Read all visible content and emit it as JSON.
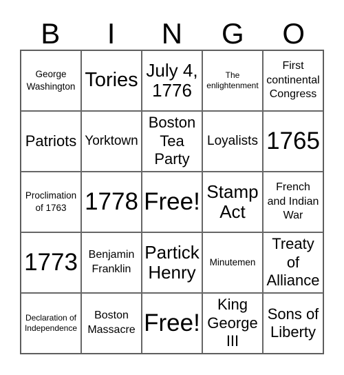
{
  "header": {
    "letters": [
      "B",
      "I",
      "N",
      "G",
      "O"
    ]
  },
  "rows": [
    [
      "George\nWashington",
      "Tories",
      "July 4,\n1776",
      "The\nenlightenment",
      "First\ncontinental\nCongress"
    ],
    [
      "Patriots",
      "Yorktown",
      "Boston\nTea\nParty",
      "Loyalists",
      "1765"
    ],
    [
      "Proclimation\nof 1763",
      "1778",
      "Free!",
      "Stamp\nAct",
      "French\nand Indian\nWar"
    ],
    [
      "1773",
      "Benjamin\nFranklin",
      "Partick\nHenry",
      "Minutemen",
      "Treaty\nof\nAlliance"
    ],
    [
      "Declaration of\nIndependence",
      "Boston\nMassacre",
      "Free!",
      "King\nGeorge\nIII",
      "Sons of\nLiberty"
    ]
  ]
}
